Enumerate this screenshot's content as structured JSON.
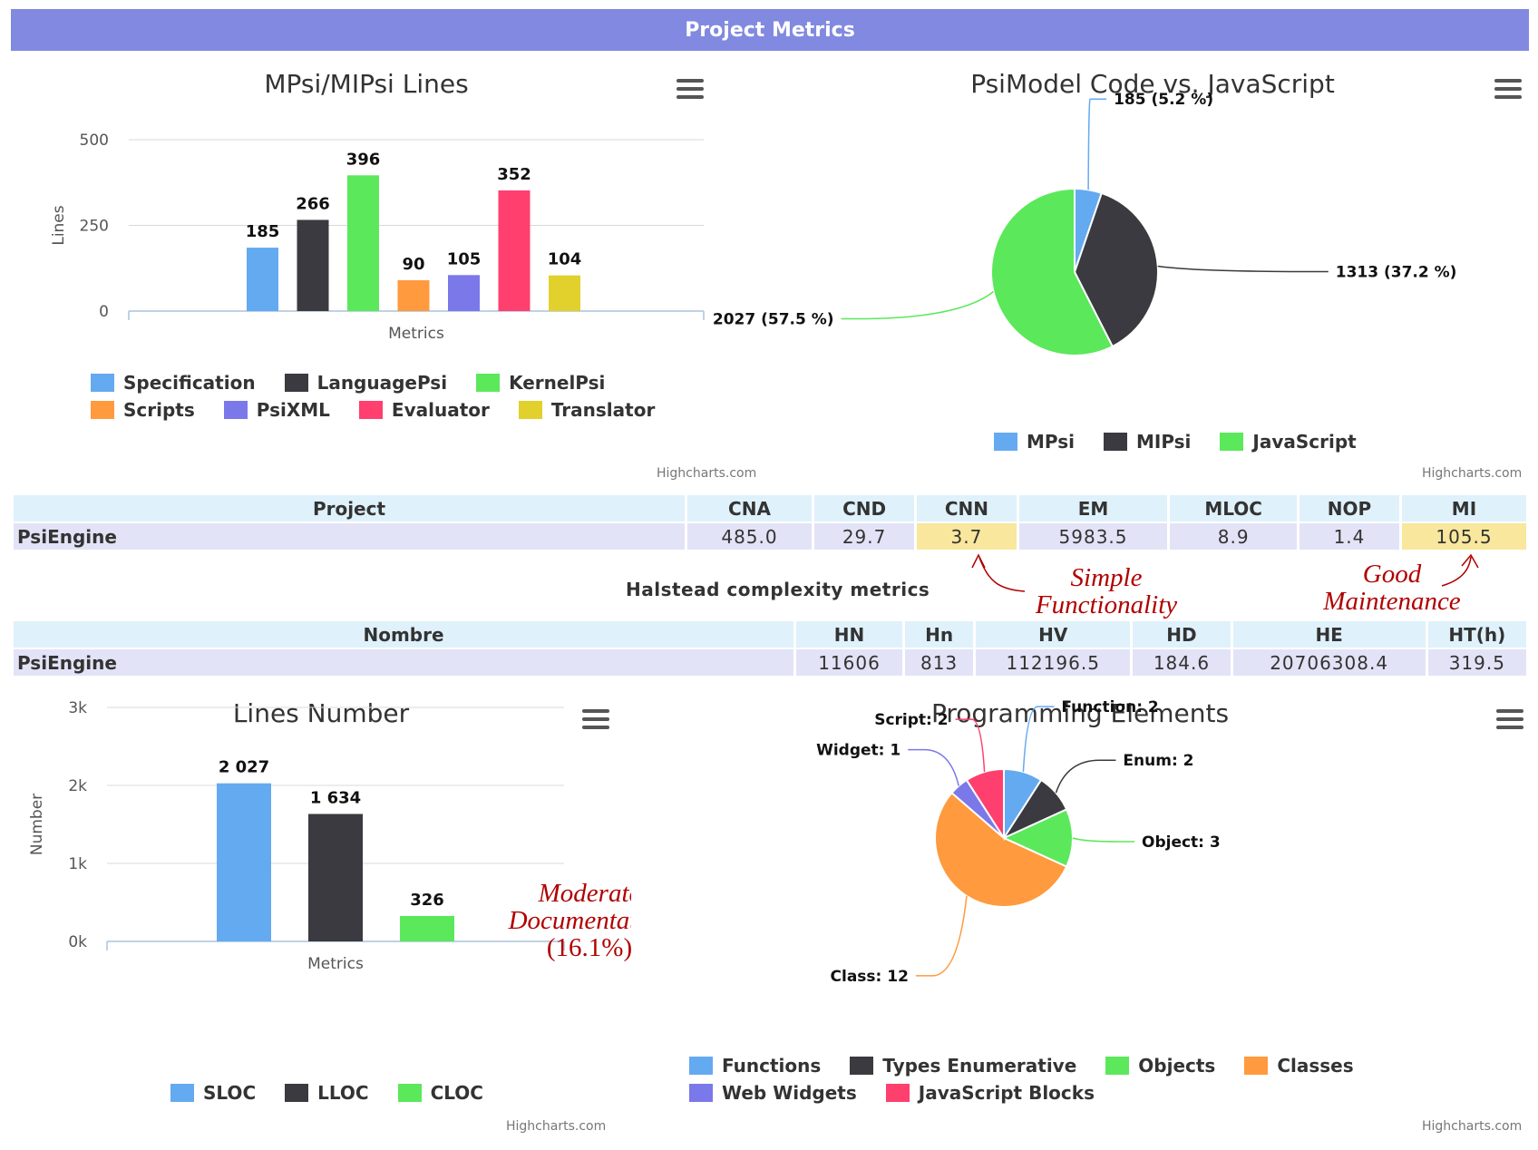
{
  "header": {
    "title": "Project Metrics"
  },
  "credit": "Highcharts.com",
  "chart_data": [
    {
      "type": "bar",
      "title": "MPsi/MIPsi Lines",
      "xlabel": "Metrics",
      "ylabel": "Lines",
      "ylim": [
        0,
        500
      ],
      "yticks": [
        "500",
        "250",
        "0"
      ],
      "legend_position": "bottom",
      "series": [
        {
          "name": "Specification",
          "value": 185,
          "color": "#64aaf0"
        },
        {
          "name": "LanguagePsi",
          "value": 266,
          "color": "#3a3a40"
        },
        {
          "name": "KernelPsi",
          "value": 396,
          "color": "#5be85b"
        },
        {
          "name": "Scripts",
          "value": 90,
          "color": "#ff9a3e"
        },
        {
          "name": "PsiXML",
          "value": 105,
          "color": "#7b78ea"
        },
        {
          "name": "Evaluator",
          "value": 352,
          "color": "#ff3f6e"
        },
        {
          "name": "Translator",
          "value": 104,
          "color": "#e2d02c"
        }
      ]
    },
    {
      "type": "pie",
      "title": "PsiModel Code vs. JavaScript",
      "legend_position": "bottom",
      "slices": [
        {
          "name": "MPsi",
          "value": 185,
          "label": "185 (5.2 %)",
          "color": "#64aaf0"
        },
        {
          "name": "MIPsi",
          "value": 1313,
          "label": "1313 (37.2 %)",
          "color": "#3a3a40"
        },
        {
          "name": "JavaScript",
          "value": 2027,
          "label": "2027 (57.5 %)",
          "color": "#5be85b"
        }
      ]
    },
    {
      "type": "bar",
      "title": "Lines Number",
      "xlabel": "Metrics",
      "ylabel": "Number",
      "ylim": [
        0,
        3000
      ],
      "yticks": [
        "3k",
        "2k",
        "1k",
        "0k"
      ],
      "legend_position": "bottom",
      "series": [
        {
          "name": "SLOC",
          "value": 2027,
          "label": "2 027",
          "color": "#64aaf0"
        },
        {
          "name": "LLOC",
          "value": 1634,
          "label": "1 634",
          "color": "#3a3a40"
        },
        {
          "name": "CLOC",
          "value": 326,
          "label": "326",
          "color": "#5be85b"
        }
      ]
    },
    {
      "type": "pie",
      "title": "Programming Elements",
      "legend_position": "bottom",
      "slices": [
        {
          "name": "Functions",
          "value": 2,
          "label": "Function: 2",
          "color": "#64aaf0"
        },
        {
          "name": "Types Enumerative",
          "value": 2,
          "label": "Enum: 2",
          "color": "#3a3a40"
        },
        {
          "name": "Objects",
          "value": 3,
          "label": "Object: 3",
          "color": "#5be85b"
        },
        {
          "name": "Classes",
          "value": 12,
          "label": "Class: 12",
          "color": "#ff9a3e"
        },
        {
          "name": "Web Widgets",
          "value": 1,
          "label": "Widget: 1",
          "color": "#7b78ea"
        },
        {
          "name": "JavaScript Blocks",
          "value": 2,
          "label": "Script: 2",
          "color": "#ff3f6e"
        }
      ]
    }
  ],
  "metrics_table": {
    "headers": [
      "Project",
      "CNA",
      "CND",
      "CNN",
      "EM",
      "MLOC",
      "NOP",
      "MI"
    ],
    "row": [
      "PsiEngine",
      "485.0",
      "29.7",
      "3.7",
      "5983.5",
      "8.9",
      "1.4",
      "105.5"
    ]
  },
  "halstead": {
    "title": "Halstead complexity metrics",
    "headers": [
      "Nombre",
      "HN",
      "Hn",
      "HV",
      "HD",
      "HE",
      "HT(h)"
    ],
    "row": [
      "PsiEngine",
      "11606",
      "813",
      "112196.5",
      "184.6",
      "20706308.4",
      "319.5"
    ]
  },
  "annotations": {
    "cnn": {
      "line1": "Simple",
      "line2": "Functionality"
    },
    "mi": {
      "line1": "Good",
      "line2": "Maintenance"
    },
    "cloc": {
      "line1": "Moderate",
      "line2": "Documentation",
      "line3": "(16.1%)"
    }
  }
}
